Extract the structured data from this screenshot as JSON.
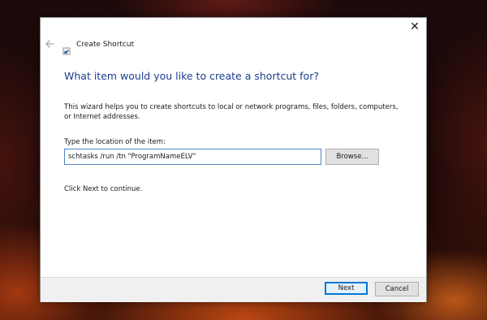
{
  "window": {
    "title": "Create Shortcut",
    "close_label": "✕",
    "back_icon": "back-arrow-icon",
    "app_icon": "shortcut-icon"
  },
  "wizard": {
    "heading": "What item would you like to create a shortcut for?",
    "description": "This wizard helps you to create shortcuts to local or network programs, files, folders, computers, or Internet addresses.",
    "location_label": "Type the location of the item:",
    "location_value": "schtasks /run /tn \"ProgramNameELV\"",
    "browse_label": "Browse...",
    "continue_text": "Click Next to continue."
  },
  "footer": {
    "next_label": "Next",
    "cancel_label": "Cancel"
  },
  "colors": {
    "heading": "#1b3d8f",
    "accent": "#0078d7",
    "input_border": "#4f87c8"
  }
}
